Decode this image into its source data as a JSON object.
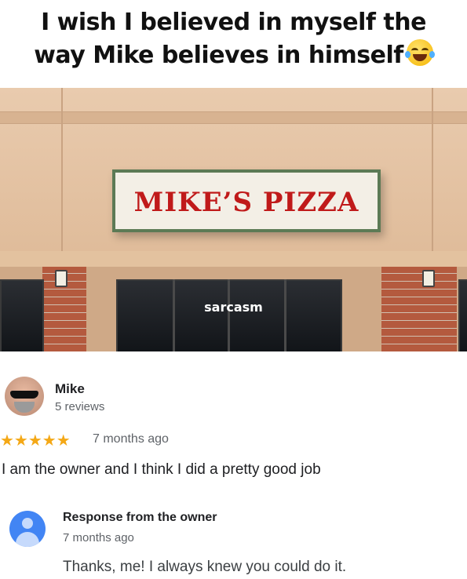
{
  "caption": {
    "line1": "I wish I believed in myself the",
    "line2": "way Mike believes in himself",
    "emoji": "tears-of-joy-emoji"
  },
  "photo": {
    "sign_text": "MIKE’S PIZZA",
    "overlay_text": "sarcasm"
  },
  "review": {
    "reviewer_name": "Mike",
    "review_count": "5 reviews",
    "rating": 5,
    "stars": "★★★★★",
    "time_ago": "7 months ago",
    "text": "I am the owner and I think I did a pretty good job"
  },
  "response": {
    "title": "Response from the owner",
    "time_ago": "7 months ago",
    "text": "Thanks, me! I always knew you could do it."
  },
  "colors": {
    "star": "#f4a816",
    "owner_avatar": "#4285f4",
    "sign_text": "#c01a1a"
  }
}
